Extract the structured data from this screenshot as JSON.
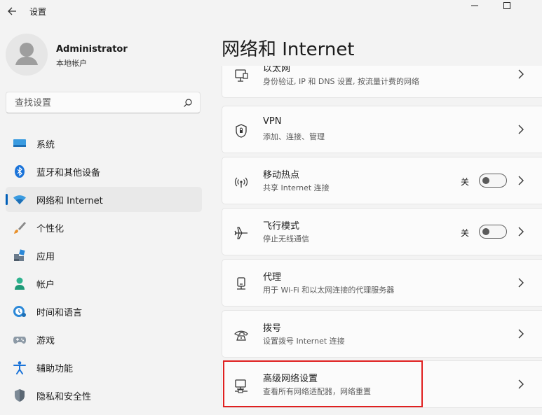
{
  "window": {
    "title": "设置"
  },
  "account": {
    "name": "Administrator",
    "type": "本地帐户"
  },
  "search": {
    "placeholder": "查找设置"
  },
  "nav": {
    "items": [
      {
        "label": "系统",
        "icon": "monitor-icon"
      },
      {
        "label": "蓝牙和其他设备",
        "icon": "bluetooth-icon"
      },
      {
        "label": "网络和 Internet",
        "icon": "wifi-icon",
        "active": true
      },
      {
        "label": "个性化",
        "icon": "brush-icon"
      },
      {
        "label": "应用",
        "icon": "apps-icon"
      },
      {
        "label": "帐户",
        "icon": "person-icon"
      },
      {
        "label": "时间和语言",
        "icon": "globe-clock-icon"
      },
      {
        "label": "游戏",
        "icon": "gamepad-icon"
      },
      {
        "label": "辅助功能",
        "icon": "accessibility-icon"
      },
      {
        "label": "隐私和安全性",
        "icon": "shield-icon"
      }
    ]
  },
  "page": {
    "title": "网络和 Internet"
  },
  "cards": [
    {
      "title": "以太网",
      "desc": "身份验证, IP 和 DNS 设置, 按流量计费的网络",
      "icon": "ethernet-icon"
    },
    {
      "title": "VPN",
      "desc": "添加、连接、管理",
      "icon": "vpn-shield-icon"
    },
    {
      "title": "移动热点",
      "desc": "共享 Internet 连接",
      "icon": "hotspot-icon",
      "toggle": {
        "label": "关",
        "on": false
      }
    },
    {
      "title": "飞行模式",
      "desc": "停止无线通信",
      "icon": "airplane-icon",
      "toggle": {
        "label": "关",
        "on": false
      }
    },
    {
      "title": "代理",
      "desc": "用于 Wi-Fi 和以太网连接的代理服务器",
      "icon": "proxy-icon"
    },
    {
      "title": "拨号",
      "desc": "设置拨号 Internet 连接",
      "icon": "dialup-icon"
    },
    {
      "title": "高级网络设置",
      "desc": "查看所有网络适配器，网络重置",
      "icon": "advanced-network-icon"
    }
  ],
  "colors": {
    "accent": "#005fb8",
    "highlight": "#e02020",
    "background": "#f3f3f3",
    "card": "#fbfbfb"
  }
}
